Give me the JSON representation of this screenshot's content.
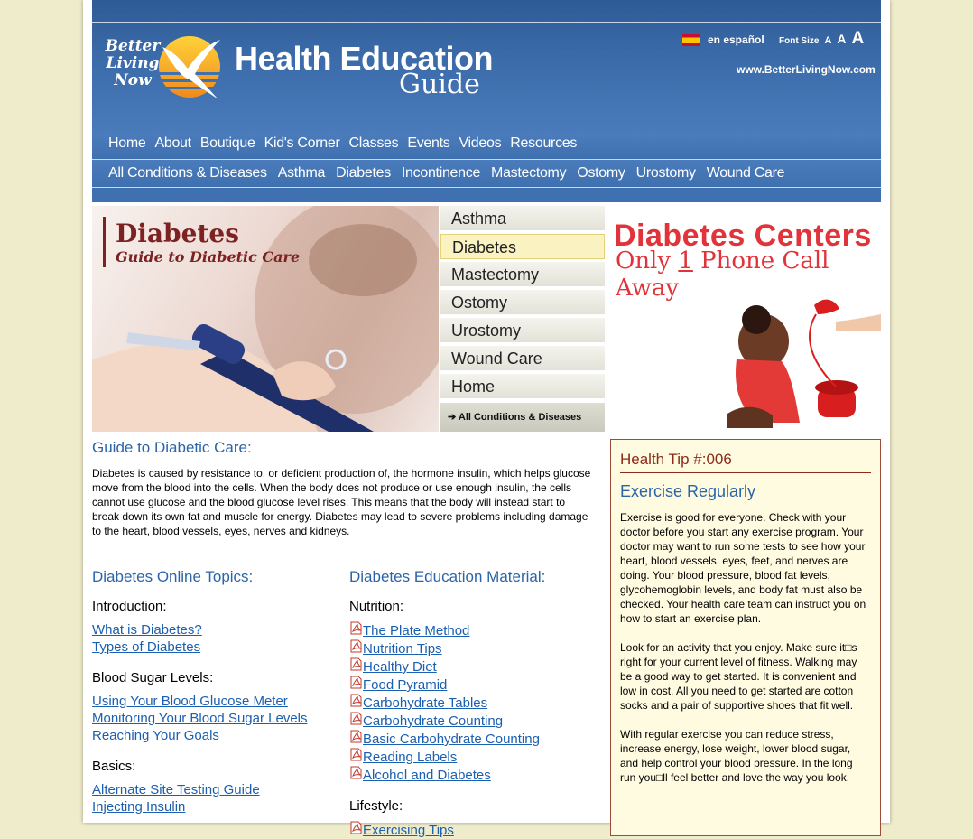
{
  "header": {
    "logo_lines": [
      "Better",
      "Living",
      "Now"
    ],
    "title": "Health Education",
    "subtitle": "Guide",
    "language": "en español",
    "font_size_label": "Font Size",
    "font_sizes": [
      "A",
      "A",
      "A"
    ],
    "url": "www.BetterLivingNow.com"
  },
  "nav_primary": [
    "Home",
    "About",
    "Boutique",
    "Kid's Corner",
    "Classes",
    "Events",
    "Videos",
    "Resources"
  ],
  "nav_secondary": [
    "All Conditions & Diseases",
    "Asthma",
    "Diabetes",
    "Incontinence",
    "Mastectomy",
    "Ostomy",
    "Urostomy",
    "Wound Care"
  ],
  "hero": {
    "title": "Diabetes",
    "subtitle": "Guide to Diabetic Care"
  },
  "side_menu": {
    "items": [
      "Asthma",
      "Diabetes",
      "Mastectomy",
      "Ostomy",
      "Urostomy",
      "Wound Care",
      "Home"
    ],
    "active": "Diabetes",
    "all_label": "All Conditions & Diseases"
  },
  "ad": {
    "line1": "Diabetes Centers",
    "line2_a": "Only ",
    "line2_num": "1",
    "line2_b": " Phone Call Away"
  },
  "content": {
    "heading": "Guide to Diabetic Care:",
    "intro": "Diabetes is caused by resistance to, or deficient production of, the hormone insulin, which helps glucose move from the blood into the cells. When the body does not produce or use enough insulin, the cells cannot use glucose and the blood glucose level rises. This means that the body will instead start to break down its own fat and muscle for energy. Diabetes may lead to severe problems including damage to the heart, blood vessels, eyes, nerves and kidneys.",
    "topics": {
      "title": "Diabetes Online Topics:",
      "sections": [
        {
          "name": "Introduction:",
          "links": [
            "What is Diabetes?",
            "Types of Diabetes"
          ]
        },
        {
          "name": "Blood Sugar Levels:",
          "links": [
            "Using Your Blood Glucose Meter",
            "Monitoring Your Blood Sugar Levels",
            "Reaching Your Goals"
          ]
        },
        {
          "name": "Basics:",
          "links": [
            "Alternate Site Testing Guide",
            "Injecting Insulin"
          ]
        }
      ]
    },
    "materials": {
      "title": "Diabetes Education Material:",
      "sections": [
        {
          "name": "Nutrition:",
          "links": [
            "The Plate Method",
            "Nutrition Tips",
            "Healthy Diet",
            "Food Pyramid",
            "Carbohydrate Tables",
            "Carbohydrate Counting",
            "Basic Carbohydrate Counting",
            "Reading Labels",
            "Alcohol and Diabetes"
          ]
        },
        {
          "name": "Lifestyle:",
          "links": [
            "Exercising Tips"
          ]
        }
      ]
    }
  },
  "health_tip": {
    "number": "Health Tip #:006",
    "title": "Exercise Regularly",
    "paragraphs": [
      "Exercise is good for everyone. Check with your doctor before you start any exercise program. Your doctor may want to run some tests to see how your heart, blood vessels, eyes, feet, and nerves are doing. Your blood pressure, blood fat levels, glycohemoglobin levels, and body fat must also be checked. Your health care team can instruct you on how to start an exercise plan.",
      "Look for an activity that you enjoy. Make sure it□s right for your current level of fitness. Walking may be a good way to get started. It is convenient and low in cost. All you need to get started are cotton socks and a pair of supportive shoes that fit well.",
      "With regular exercise you can reduce stress, increase energy, lose weight, lower blood sugar, and help control your blood pressure. In the long run you□ll feel better and love the way you look."
    ]
  }
}
